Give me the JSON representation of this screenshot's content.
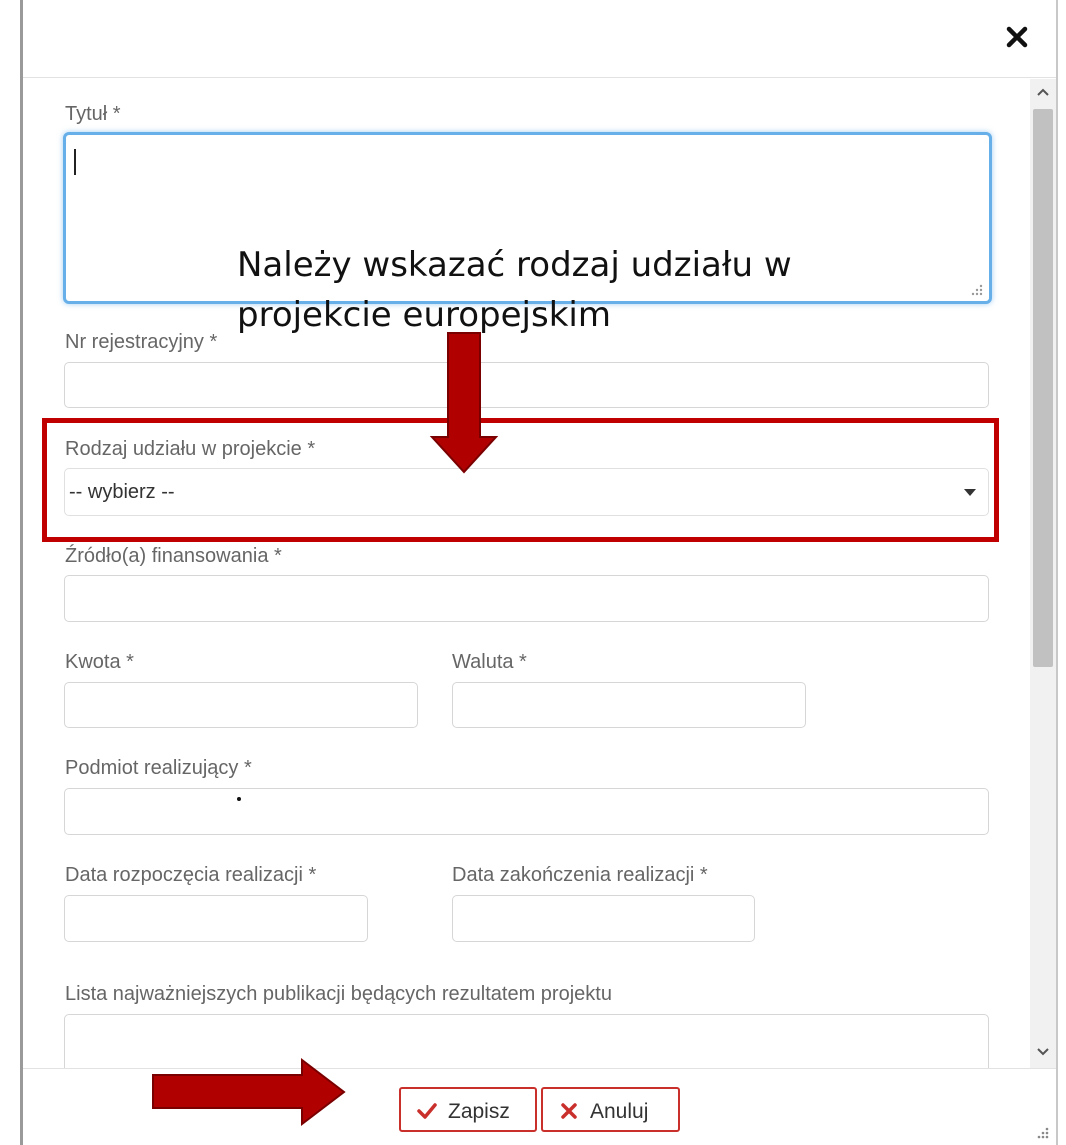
{
  "dialog": {
    "close_icon": "close-icon"
  },
  "form": {
    "title_label": "Tytuł *",
    "title_value": "",
    "reg_number_label": "Nr rejestracyjny *",
    "reg_number_value": "",
    "participation_label": "Rodzaj udziału w projekcie *",
    "participation_selected": "-- wybierz --",
    "funding_label": "Źródło(a) finansowania *",
    "funding_value": "",
    "amount_label": "Kwota *",
    "amount_value": "",
    "currency_label": "Waluta *",
    "currency_value": "",
    "entity_label": "Podmiot realizujący *",
    "entity_value": "",
    "start_date_label": "Data rozpoczęcia realizacji *",
    "start_date_value": "",
    "end_date_label": "Data zakończenia realizacji *",
    "end_date_value": "",
    "publications_label": "Lista najważniejszych publikacji będących rezultatem projektu",
    "publications_value": ""
  },
  "footer": {
    "save_label": "Zapisz",
    "cancel_label": "Anuluj",
    "save_icon": "check-icon",
    "cancel_icon": "x-icon"
  },
  "annotation": {
    "text_line1": "Należy wskazać rodzaj udziału w",
    "text_line2": "projekcie europejskim",
    "highlight_color": "#c00000",
    "arrow_color": "#b00000"
  },
  "colors": {
    "focus_border": "#66afe9",
    "button_border": "#c9302c",
    "scroll_thumb": "#c1c1c1"
  }
}
